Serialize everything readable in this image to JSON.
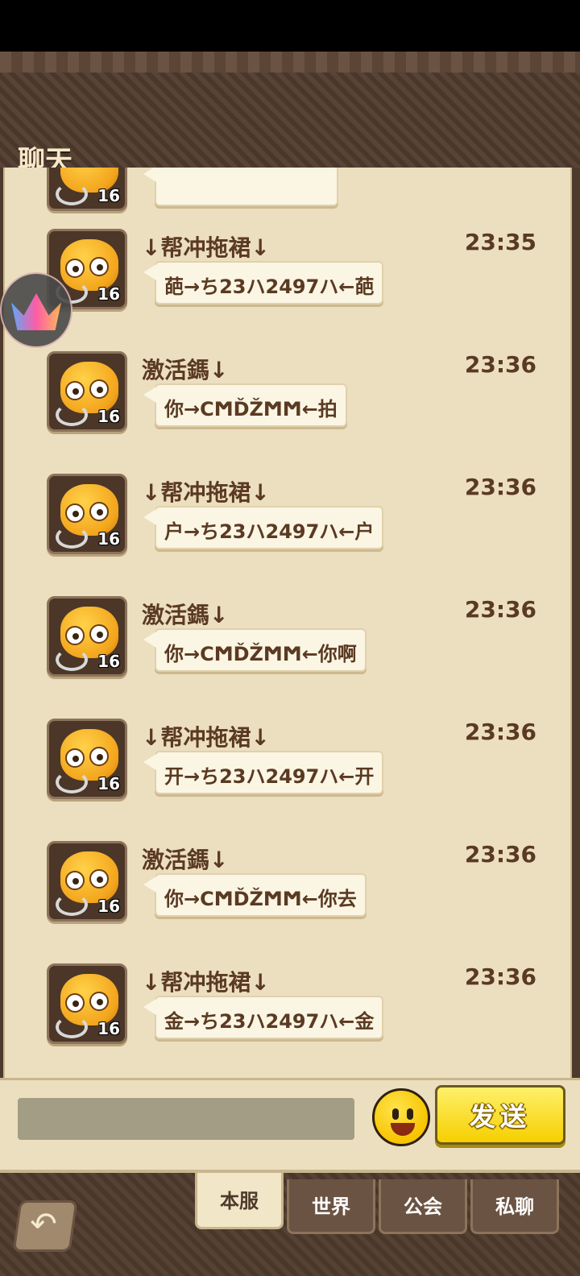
{
  "header": {
    "title": "聊天"
  },
  "messages": [
    {
      "sender": "↓帮冲拖裙↓",
      "time": "23:35",
      "text": "葩→ち23ハ2497ハ←葩",
      "level": "16"
    },
    {
      "sender": "激活鎷↓",
      "time": "23:36",
      "text": "你→CϺĎŽϺϺ←拍",
      "level": "16"
    },
    {
      "sender": "↓帮冲拖裙↓",
      "time": "23:36",
      "text": "户→ち23ハ2497ハ←户",
      "level": "16"
    },
    {
      "sender": "激活鎷↓",
      "time": "23:36",
      "text": "你→CϺĎŽϺϺ←你啊",
      "level": "16"
    },
    {
      "sender": "↓帮冲拖裙↓",
      "time": "23:36",
      "text": "开→ち23ハ2497ハ←开",
      "level": "16"
    },
    {
      "sender": "激活鎷↓",
      "time": "23:36",
      "text": "你→CϺĎŽϺϺ←你去",
      "level": "16"
    },
    {
      "sender": "↓帮冲拖裙↓",
      "time": "23:36",
      "text": "金→ち23ハ2497ハ←金",
      "level": "16"
    }
  ],
  "partial_message": {
    "level": "16"
  },
  "input": {
    "value": "",
    "placeholder": ""
  },
  "send_label": "发送",
  "tabs": [
    {
      "label": "本服",
      "active": true
    },
    {
      "label": "世界",
      "active": false
    },
    {
      "label": "公会",
      "active": false
    },
    {
      "label": "私聊",
      "active": false
    }
  ],
  "icons": {
    "back": "back-arrow-icon",
    "emoji": "smiley-icon",
    "floating": "crown-icon"
  },
  "colors": {
    "header_bg": "#4e3a2c",
    "panel_bg": "#ecdfbf",
    "text": "#5a3a22",
    "send_button": "#f5cf00"
  }
}
